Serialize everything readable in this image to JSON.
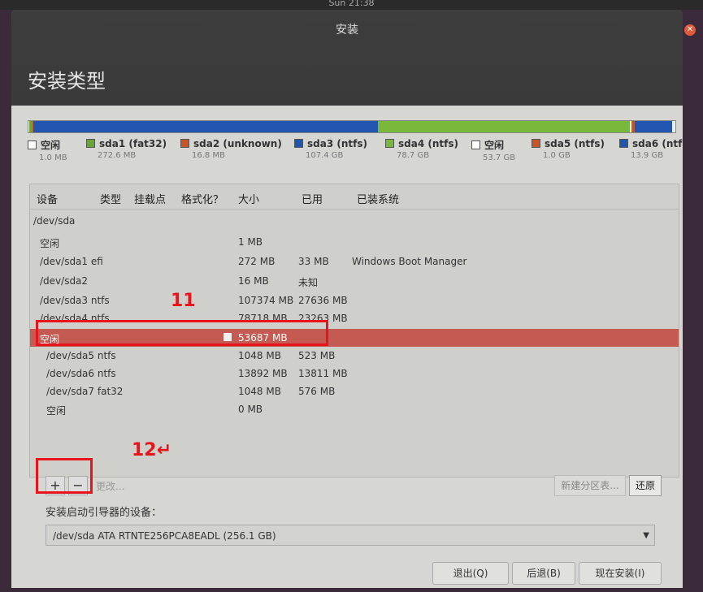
{
  "topbar": {
    "clock": "Sun 21:38"
  },
  "window": {
    "title": "安装",
    "page_title": "安装类型"
  },
  "disk_segments": [
    {
      "color": "#ffffff"
    },
    {
      "color": "#6aa632"
    },
    {
      "color": "#c8542a"
    },
    {
      "color": "#2255b0"
    },
    {
      "color": "#79b83a"
    },
    {
      "color": "#eeeeee"
    },
    {
      "color": "#c8542a"
    },
    {
      "color": "#2255b0"
    }
  ],
  "legend": [
    {
      "name": "空闲",
      "size": "1.0 MB",
      "color": "#ffffff"
    },
    {
      "name": "sda1 (fat32)",
      "size": "272.6 MB",
      "color": "#6aa632"
    },
    {
      "name": "sda2 (unknown)",
      "size": "16.8 MB",
      "color": "#c8542a"
    },
    {
      "name": "sda3 (ntfs)",
      "size": "107.4 GB",
      "color": "#2255b0"
    },
    {
      "name": "sda4 (ntfs)",
      "size": "78.7 GB",
      "color": "#79b83a"
    },
    {
      "name": "空闲",
      "size": "53.7 GB",
      "color": "#ffffff"
    },
    {
      "name": "sda5 (ntfs)",
      "size": "1.0 GB",
      "color": "#c8542a"
    },
    {
      "name": "sda6 (ntf",
      "size": "13.9 GB",
      "color": "#2255b0"
    }
  ],
  "table": {
    "headers": [
      "设备",
      "类型",
      "挂载点",
      "格式化？",
      "大小",
      "已用",
      "已装系统"
    ],
    "rows": [
      {
        "device": "/dev/sda",
        "type": "",
        "size": "",
        "used": "",
        "system": ""
      },
      {
        "device": "空闲",
        "type": "",
        "size": "1 MB",
        "used": "",
        "system": ""
      },
      {
        "device": "/dev/sda1",
        "type": "efi",
        "size": "272 MB",
        "used": "33 MB",
        "system": "Windows Boot Manager"
      },
      {
        "device": "/dev/sda2",
        "type": "",
        "size": "16 MB",
        "used": "未知",
        "system": ""
      },
      {
        "device": "/dev/sda3",
        "type": "ntfs",
        "size": "107374 MB",
        "used": "27636 MB",
        "system": ""
      },
      {
        "device": "/dev/sda4",
        "type": "ntfs",
        "size": "78718 MB",
        "used": "23263 MB",
        "system": ""
      },
      {
        "device": "空闲",
        "type": "",
        "size": "53687 MB",
        "used": "",
        "system": ""
      },
      {
        "device": "/dev/sda5",
        "type": "ntfs",
        "size": "1048 MB",
        "used": "523 MB",
        "system": ""
      },
      {
        "device": "/dev/sda6",
        "type": "ntfs",
        "size": "13892 MB",
        "used": "13811 MB",
        "system": ""
      },
      {
        "device": "/dev/sda7",
        "type": "fat32",
        "size": "1048 MB",
        "used": "576 MB",
        "system": ""
      },
      {
        "device": "空闲",
        "type": "",
        "size": "0 MB",
        "used": "",
        "system": ""
      }
    ]
  },
  "annotations": {
    "label_11": "11",
    "label_12": "12↵"
  },
  "toolbar": {
    "add": "+",
    "remove": "−",
    "change": "更改...",
    "new_table": "新建分区表...",
    "revert": "还原"
  },
  "boot": {
    "label": "安装启动引导器的设备：",
    "value": "/dev/sda   ATA RTNTE256PCA8EADL (256.1 GB)"
  },
  "footer": {
    "quit": "退出(Q)",
    "back": "后退(B)",
    "install_now": "现在安装(I)"
  },
  "colors": {
    "selected_row": "#c45a52",
    "annotation": "#e8141c"
  }
}
